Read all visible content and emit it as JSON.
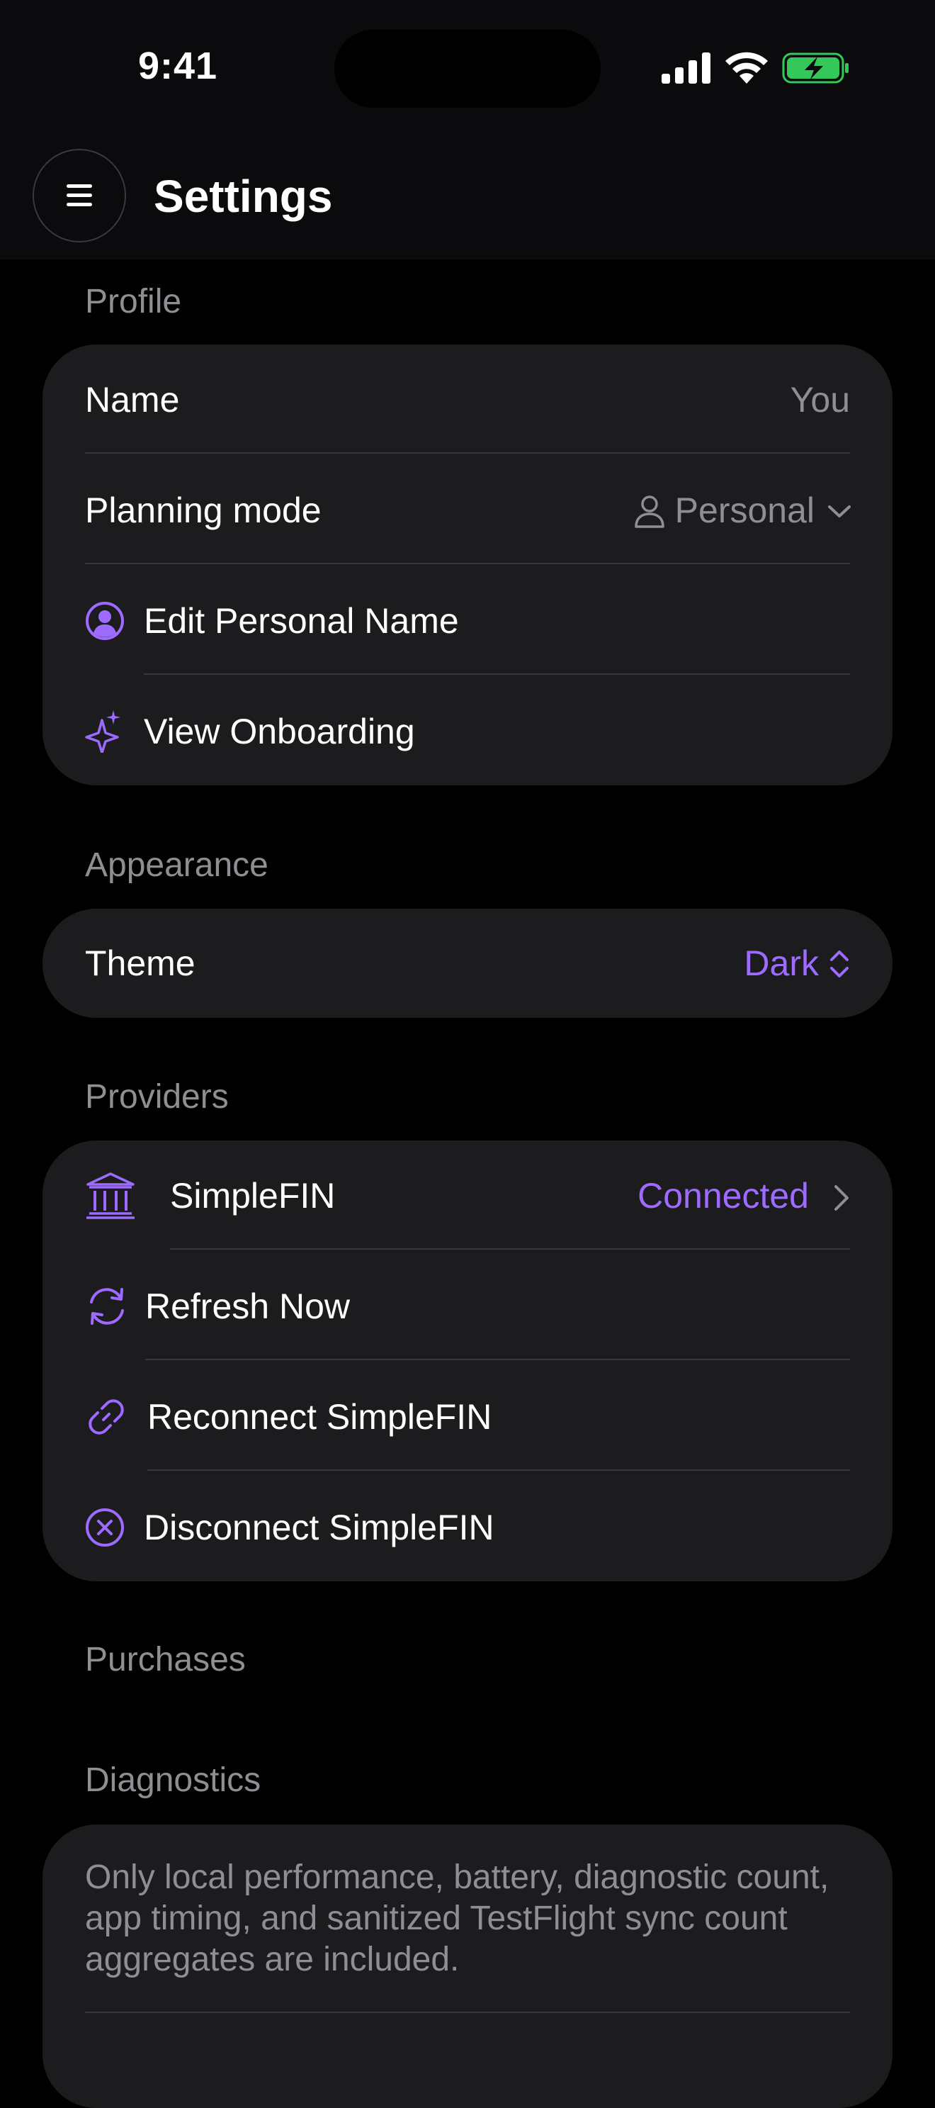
{
  "status_bar": {
    "time": "9:41"
  },
  "header": {
    "title": "Settings",
    "menu_icon": "hamburger-icon"
  },
  "colors": {
    "accent": "#9d6bff",
    "card": "#1c1c1e",
    "secondary_text": "#8e8e93",
    "battery": "#34c759"
  },
  "profile": {
    "section_label": "Profile",
    "name_label": "Name",
    "name_value": "You",
    "planning_mode_label": "Planning mode",
    "planning_mode_value": "Personal",
    "edit_name_label": "Edit Personal Name",
    "view_onboarding_label": "View Onboarding"
  },
  "appearance": {
    "section_label": "Appearance",
    "theme_label": "Theme",
    "theme_value": "Dark"
  },
  "providers": {
    "section_label": "Providers",
    "simplefin_label": "SimpleFIN",
    "simplefin_status": "Connected",
    "refresh_label": "Refresh Now",
    "reconnect_label": "Reconnect SimpleFIN",
    "disconnect_label": "Disconnect SimpleFIN"
  },
  "purchases": {
    "section_label": "Purchases"
  },
  "diagnostics": {
    "section_label": "Diagnostics",
    "note": "Only local performance, battery, diagnostic count, app timing, and sanitized TestFlight sync count aggregates are included."
  }
}
